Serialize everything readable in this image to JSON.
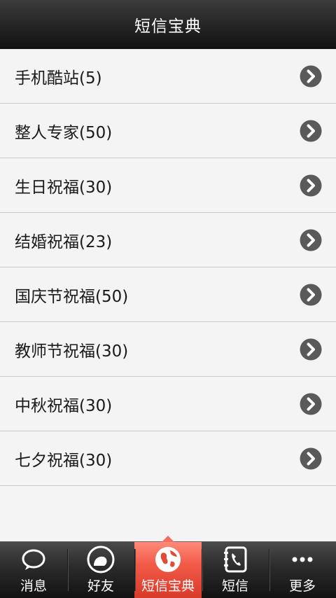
{
  "header": {
    "title": "短信宝典"
  },
  "list": {
    "items": [
      {
        "label": "手机酷站(5)"
      },
      {
        "label": "整人专家(50)"
      },
      {
        "label": "生日祝福(30)"
      },
      {
        "label": "结婚祝福(23)"
      },
      {
        "label": "国庆节祝福(50)"
      },
      {
        "label": "教师节祝福(30)"
      },
      {
        "label": "中秋祝福(30)"
      },
      {
        "label": "七夕祝福(30)"
      }
    ],
    "arrow_icon": "chevron-right-circle-icon",
    "arrow_color": "#5a5a5a"
  },
  "tabbar": {
    "active_color": "#f25a48",
    "tabs": [
      {
        "label": "消息",
        "icon": "speech-bubble-icon",
        "active": false
      },
      {
        "label": "好友",
        "icon": "friend-circle-icon",
        "active": false
      },
      {
        "label": "短信宝典",
        "icon": "globe-icon",
        "active": true
      },
      {
        "label": "短信",
        "icon": "phone-book-icon",
        "active": false
      },
      {
        "label": "更多",
        "icon": "more-dots-icon",
        "active": false
      }
    ]
  }
}
